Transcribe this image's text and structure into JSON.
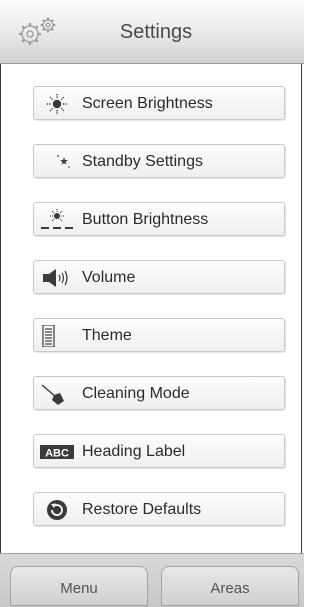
{
  "header": {
    "title": "Settings",
    "icon": "gears-icon"
  },
  "menu_items": [
    {
      "label": "Screen Brightness",
      "icon": "sun-brightness-icon"
    },
    {
      "label": "Standby Settings",
      "icon": "moon-star-icon"
    },
    {
      "label": "Button Brightness",
      "icon": "button-brightness-icon"
    },
    {
      "label": "Volume",
      "icon": "speaker-icon"
    },
    {
      "label": "Theme",
      "icon": "theme-list-icon"
    },
    {
      "label": "Cleaning Mode",
      "icon": "broom-icon"
    },
    {
      "label": "Heading Label",
      "icon": "abc-label-icon",
      "icon_text": "ABC"
    },
    {
      "label": "Restore Defaults",
      "icon": "restore-icon"
    }
  ],
  "footer": {
    "tabs": [
      {
        "label": "Menu"
      },
      {
        "label": "Areas"
      }
    ]
  },
  "colors": {
    "text": "#2b2b2b",
    "header_title": "#4a4a4a",
    "border": "#3a3a3a"
  }
}
